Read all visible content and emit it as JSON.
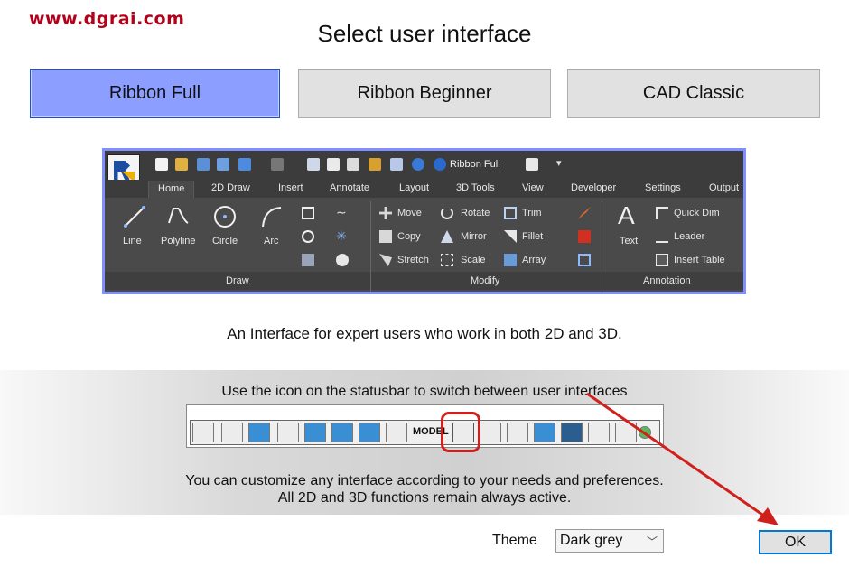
{
  "watermark": "www.dgrai.com",
  "dialog": {
    "title": "Select user interface",
    "options": [
      {
        "label": "Ribbon Full",
        "selected": true
      },
      {
        "label": "Ribbon Beginner",
        "selected": false
      },
      {
        "label": "CAD Classic",
        "selected": false
      }
    ],
    "selected_color": "#8c9eff",
    "description": "An Interface for expert users who work in both 2D and 3D.",
    "hint_statusbar": "Use the icon on the statusbar to switch between user interfaces",
    "hint_customize_line1": "You can customize any interface according to your needs and preferences.",
    "hint_customize_line2": "All 2D and 3D functions remain always active.",
    "theme_label": "Theme",
    "theme_value": "Dark grey",
    "ok_label": "OK",
    "highlight_color": "#d0201e"
  },
  "ribbon_preview": {
    "qat_label": "Ribbon Full",
    "tabs": [
      "Home",
      "2D Draw",
      "Insert",
      "Annotate",
      "Layout",
      "3D Tools",
      "View",
      "Developer",
      "Settings",
      "Output"
    ],
    "active_tab": "Home",
    "draw_tools": [
      "Line",
      "Polyline",
      "Circle",
      "Arc"
    ],
    "modify_tools": [
      "Move",
      "Rotate",
      "Trim",
      "Copy",
      "Mirror",
      "Fillet",
      "Stretch",
      "Scale",
      "Array"
    ],
    "annotation_tools": [
      "Text",
      "Quick Dim",
      "Leader",
      "Insert Table"
    ],
    "panels": [
      "Draw",
      "Modify",
      "Annotation"
    ]
  },
  "statusbar_preview": {
    "model_label": "MODEL"
  }
}
